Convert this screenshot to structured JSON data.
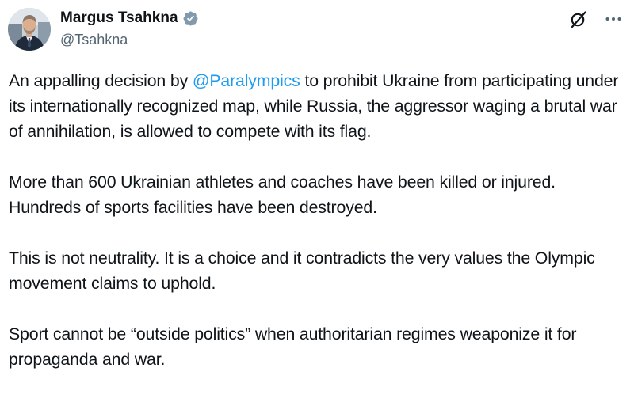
{
  "author": {
    "display_name": "Margus Tsahkna",
    "handle": "@Tsahkna",
    "verified": true
  },
  "icons": {
    "verified": "verified-badge-icon",
    "grok": "grok-icon",
    "more": "more-icon"
  },
  "tweet": {
    "p1_before": "An appalling decision by ",
    "p1_mention": "@Paralympics",
    "p1_after": " to prohibit Ukraine from participating under its internationally recognized map, while Russia, the aggressor waging a brutal war of annihilation, is allowed to compete with its flag.",
    "p2": "More than 600 Ukrainian athletes and coaches have been killed or injured. Hundreds of sports facilities have been destroyed.",
    "p3": "This is not neutrality. It is a choice and it contradicts the very values the Olympic movement claims to uphold.",
    "p4": "Sport cannot be “outside politics” when authoritarian regimes weaponize it for propaganda and war."
  },
  "colors": {
    "text": "#0f1419",
    "secondary": "#536471",
    "link": "#1d9bf0",
    "badge": "#829aab"
  }
}
